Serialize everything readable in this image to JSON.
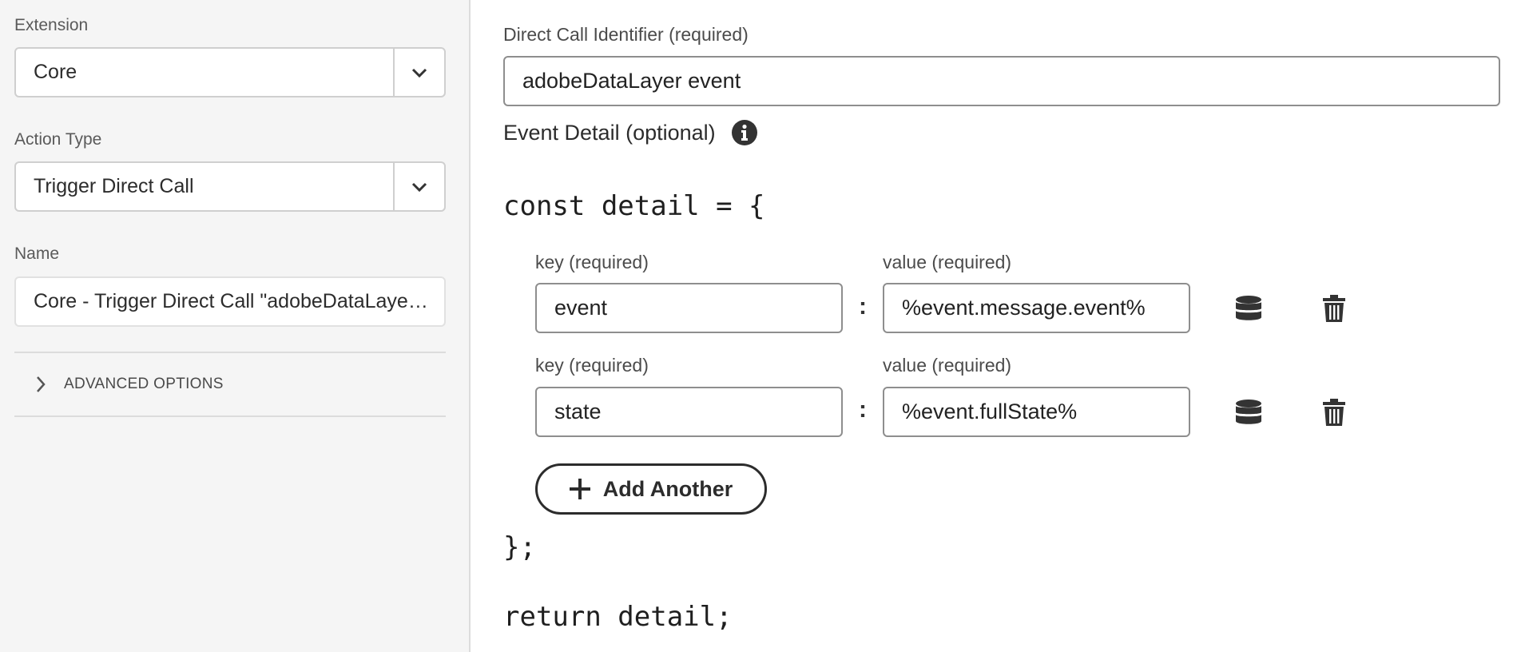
{
  "sidebar": {
    "extension": {
      "label": "Extension",
      "value": "Core"
    },
    "action_type": {
      "label": "Action Type",
      "value": "Trigger Direct Call"
    },
    "name": {
      "label": "Name",
      "value": "Core - Trigger Direct Call \"adobeDataLayer event\""
    },
    "advanced_options": {
      "label": "ADVANCED OPTIONS"
    }
  },
  "main": {
    "identifier": {
      "label": "Direct Call Identifier (required)",
      "value": "adobeDataLayer event"
    },
    "event_detail": {
      "label": "Event Detail (optional)"
    },
    "code_open": "const detail = {",
    "code_close": "};",
    "code_return": "return detail;",
    "rows": [
      {
        "key_label": "key (required)",
        "key": "event",
        "value_label": "value (required)",
        "value": "%event.message.event%"
      },
      {
        "key_label": "key (required)",
        "key": "state",
        "value_label": "value (required)",
        "value": "%event.fullState%"
      }
    ],
    "separator": ":",
    "add_another": "Add Another"
  },
  "icons": {
    "dropdown": "chevron-down-icon",
    "expand": "chevron-right-icon",
    "info": "info-icon",
    "data_element": "database-icon",
    "delete": "trash-icon",
    "add": "plus-icon"
  }
}
